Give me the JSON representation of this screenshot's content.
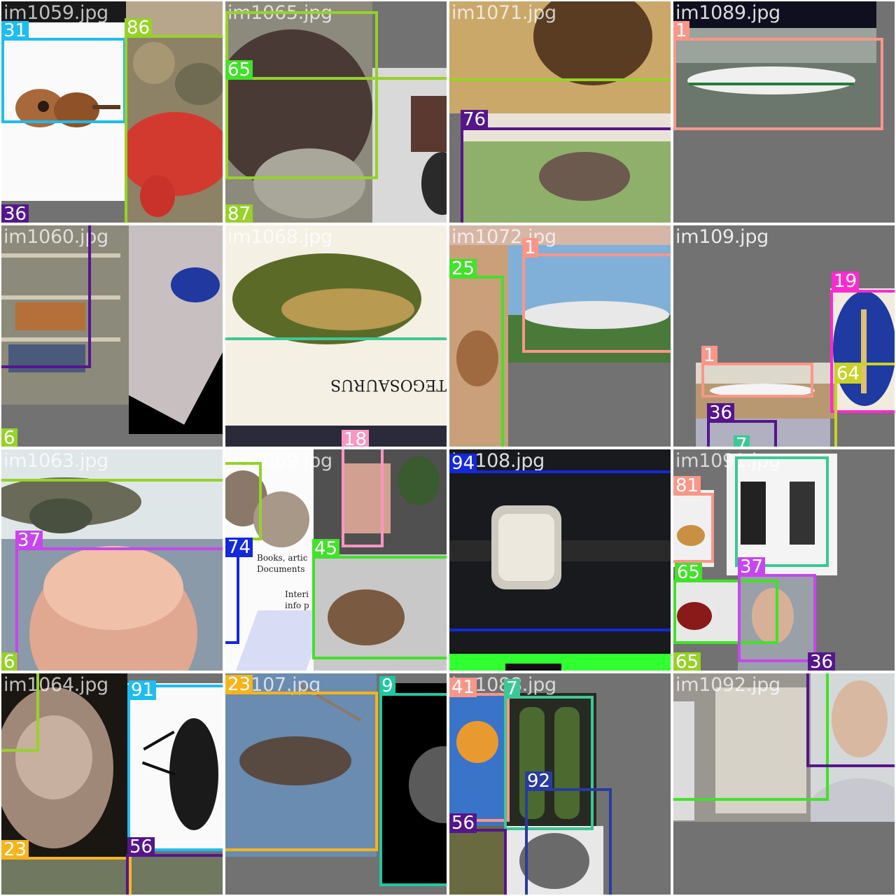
{
  "mosaic": {
    "tiles": [
      {
        "filename": "im1059.jpg",
        "labels": [
          "31",
          "86",
          "36"
        ]
      },
      {
        "filename": "im1065.jpg",
        "labels": [
          "65",
          "87"
        ]
      },
      {
        "filename": "im1071.jpg",
        "labels": [
          "76"
        ]
      },
      {
        "filename": "im1089.jpg",
        "labels": [
          "1"
        ]
      },
      {
        "filename": "im1060.jpg",
        "labels": [
          "6"
        ]
      },
      {
        "filename": "im1068.jpg",
        "labels": [
          "18"
        ]
      },
      {
        "filename": "im1072.jpg",
        "labels": [
          "25",
          "1"
        ]
      },
      {
        "filename": "im109.jpg",
        "labels": [
          "19",
          "1",
          "64",
          "36",
          "7"
        ]
      },
      {
        "filename": "im1063.jpg",
        "labels": [
          "37",
          "6"
        ]
      },
      {
        "filename": "im1069.jpg",
        "labels": [
          "74",
          "45"
        ]
      },
      {
        "filename": "im108.jpg",
        "labels": [
          "94"
        ]
      },
      {
        "filename": "im1091.jpg",
        "labels": [
          "81",
          "65",
          "37",
          "65",
          "36"
        ]
      },
      {
        "filename": "im1064.jpg",
        "labels": [
          "91",
          "23",
          "56"
        ]
      },
      {
        "filename": "im107.jpg",
        "labels": [
          "23",
          "9"
        ]
      },
      {
        "filename": "im1088.jpg",
        "labels": [
          "41",
          "7",
          "92",
          "56"
        ]
      },
      {
        "filename": "im1092.jpg",
        "labels": []
      }
    ],
    "image_text": {
      "stego": "STEGOSAURUS",
      "doc_line1": "Books, artic",
      "doc_line2": "Documents",
      "doc_line3": "Interi",
      "doc_line4": "info p"
    }
  }
}
